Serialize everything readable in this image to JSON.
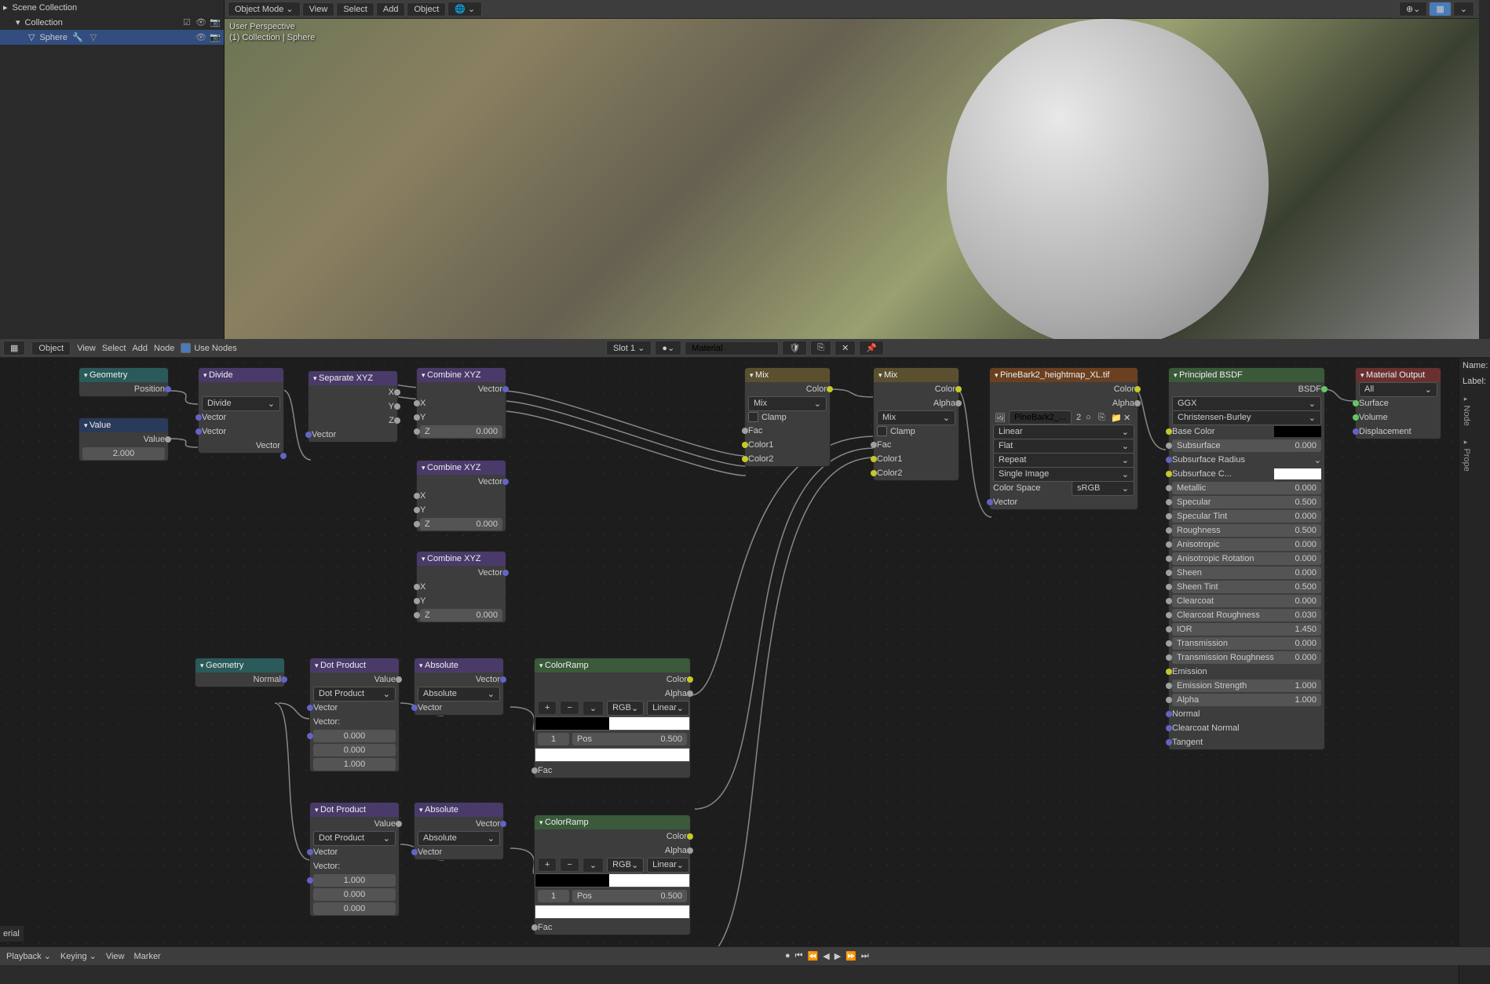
{
  "outliner": {
    "scene": "Scene Collection",
    "coll": "Collection",
    "obj": "Sphere"
  },
  "viewport": {
    "mode": "Object Mode",
    "menu_view": "View",
    "menu_select": "Select",
    "menu_add": "Add",
    "menu_object": "Object",
    "overlay_line1": "User Perspective",
    "overlay_line2": "(1) Collection | Sphere"
  },
  "node_header": {
    "editor": "Object",
    "menu_view": "View",
    "menu_select": "Select",
    "menu_add": "Add",
    "menu_node": "Node",
    "use_nodes": "Use Nodes",
    "slot": "Slot 1",
    "material": "Material"
  },
  "side": {
    "name": "Name:",
    "label": "Label:",
    "node": "Node",
    "prop": "Prope"
  },
  "nodes": {
    "geometry1": {
      "title": "Geometry",
      "position": "Position"
    },
    "value": {
      "title": "Value",
      "label": "Value",
      "val": "2.000"
    },
    "divide": {
      "title": "Divide",
      "mode": "Divide",
      "vector": "Vector",
      "vector2": "Vector"
    },
    "separate": {
      "title": "Separate XYZ",
      "x": "X",
      "y": "Y",
      "z": "Z",
      "vector": "Vector"
    },
    "combine1": {
      "title": "Combine XYZ",
      "vector": "Vector",
      "x": "X",
      "y": "Y",
      "z": "Z",
      "zval": "0.000"
    },
    "combine2": {
      "title": "Combine XYZ",
      "vector": "Vector",
      "x": "X",
      "y": "Y",
      "z": "Z",
      "zval": "0.000"
    },
    "combine3": {
      "title": "Combine XYZ",
      "vector": "Vector",
      "x": "X",
      "y": "Y",
      "z": "Z",
      "zval": "0.000"
    },
    "mix1": {
      "title": "Mix",
      "color": "Color",
      "mode": "Mix",
      "clamp": "Clamp",
      "fac": "Fac",
      "c1": "Color1",
      "c2": "Color2"
    },
    "mix2": {
      "title": "Mix",
      "color": "Color",
      "alpha": "Alpha",
      "mode": "Mix",
      "clamp": "Clamp",
      "fac": "Fac",
      "c1": "Color1",
      "c2": "Color2"
    },
    "image": {
      "title": "PineBark2_heightmap_XL.tif",
      "file": "PineBark2_...",
      "num": "2",
      "interp": "Linear",
      "proj": "Flat",
      "ext": "Repeat",
      "src": "Single Image",
      "cspace_lbl": "Color Space",
      "cspace": "sRGB",
      "vector": "Vector"
    },
    "bsdf": {
      "title": "Principled BSDF",
      "bsdf": "BSDF",
      "dist": "GGX",
      "sss": "Christensen-Burley",
      "base_color": "Base Color",
      "subsurface": "Subsurface",
      "subsurface_v": "0.000",
      "subsurf_rad": "Subsurface Radius",
      "subsurf_c": "Subsurface C...",
      "metallic": "Metallic",
      "metallic_v": "0.000",
      "specular": "Specular",
      "specular_v": "0.500",
      "spec_tint": "Specular Tint",
      "spec_tint_v": "0.000",
      "roughness": "Roughness",
      "roughness_v": "0.500",
      "aniso": "Anisotropic",
      "aniso_v": "0.000",
      "aniso_rot": "Anisotropic Rotation",
      "aniso_rot_v": "0.000",
      "sheen": "Sheen",
      "sheen_v": "0.000",
      "sheen_tint": "Sheen Tint",
      "sheen_tint_v": "0.500",
      "clearcoat": "Clearcoat",
      "clearcoat_v": "0.000",
      "cc_rough": "Clearcoat Roughness",
      "cc_rough_v": "0.030",
      "ior": "IOR",
      "ior_v": "1.450",
      "trans": "Transmission",
      "trans_v": "0.000",
      "trans_rough": "Transmission Roughness",
      "trans_rough_v": "0.000",
      "emission": "Emission",
      "em_str": "Emission Strength",
      "em_str_v": "1.000",
      "alpha": "Alpha",
      "alpha_v": "1.000",
      "normal": "Normal",
      "cc_normal": "Clearcoat Normal",
      "tangent": "Tangent"
    },
    "output": {
      "title": "Material Output",
      "all": "All",
      "surface": "Surface",
      "volume": "Volume",
      "disp": "Displacement"
    },
    "geometry2": {
      "title": "Geometry",
      "normal": "Normal"
    },
    "dot1": {
      "title": "Dot Product",
      "value": "Value",
      "mode": "Dot Product",
      "vector": "Vector",
      "veclbl": "Vector:",
      "v0": "0.000",
      "v1": "0.000",
      "v2": "1.000"
    },
    "dot2": {
      "title": "Dot Product",
      "value": "Value",
      "mode": "Dot Product",
      "vector": "Vector",
      "veclbl": "Vector:",
      "v0": "1.000",
      "v1": "0.000",
      "v2": "0.000"
    },
    "abs1": {
      "title": "Absolute",
      "vector": "Vector",
      "mode": "Absolute"
    },
    "abs2": {
      "title": "Absolute",
      "vector": "Vector",
      "mode": "Absolute"
    },
    "ramp1": {
      "title": "ColorRamp",
      "color": "Color",
      "alpha": "Alpha",
      "rgb": "RGB",
      "linear": "Linear",
      "idx": "1",
      "pos_lbl": "Pos",
      "pos": "0.500",
      "fac": "Fac"
    },
    "ramp2": {
      "title": "ColorRamp",
      "color": "Color",
      "alpha": "Alpha",
      "rgb": "RGB",
      "linear": "Linear",
      "idx": "1",
      "pos_lbl": "Pos",
      "pos": "0.500",
      "fac": "Fac"
    }
  },
  "timeline": {
    "playback": "Playback",
    "keying": "Keying",
    "view": "View",
    "marker": "Marker"
  },
  "erial": "erial"
}
